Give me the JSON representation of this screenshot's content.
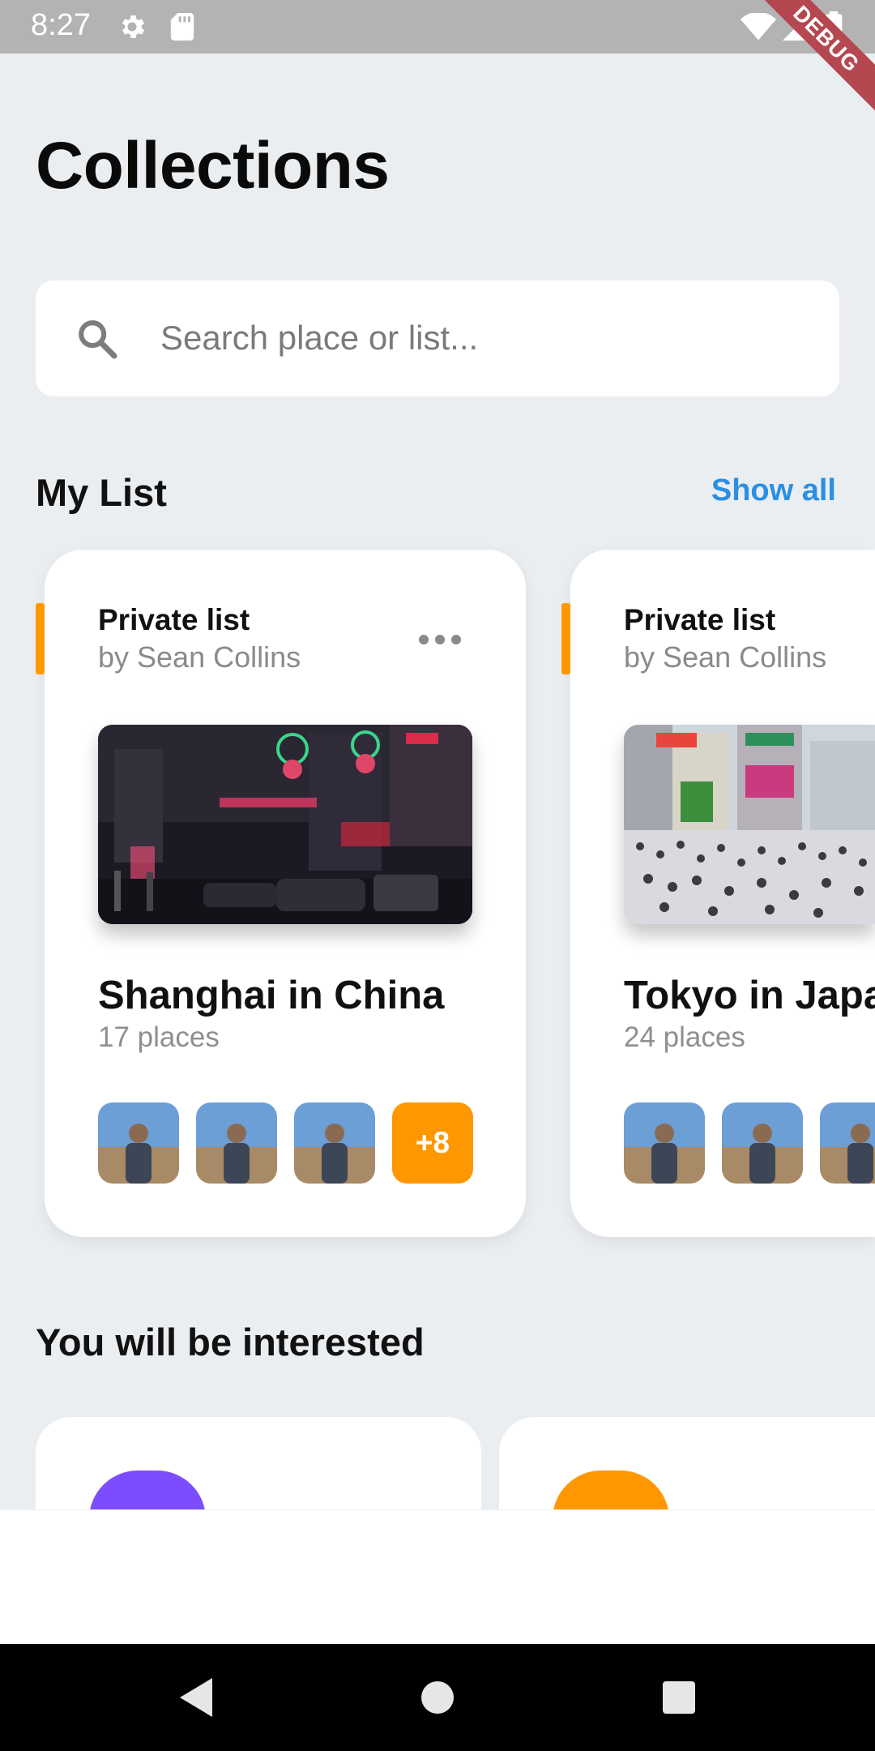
{
  "status_bar": {
    "time": "8:27",
    "icons": [
      "gear-icon",
      "sd-card-icon",
      "wifi-icon",
      "cell-signal-icon",
      "battery-icon"
    ],
    "debug_label": "DEBUG"
  },
  "header": {
    "title": "Collections"
  },
  "search": {
    "placeholder": "Search place or list...",
    "value": ""
  },
  "my_list": {
    "title": "My List",
    "show_all_label": "Show all",
    "cards": [
      {
        "type": "Private list",
        "author": "by Sean Collins",
        "title": "Shanghai in China",
        "count": "17 places",
        "more_badge": "+8"
      },
      {
        "type": "Private list",
        "author": "by Sean Collins",
        "title": "Tokyo in Japan",
        "count": "24 places"
      }
    ]
  },
  "interested": {
    "title": "You will be interested"
  },
  "colors": {
    "accent_orange": "#ff9800",
    "link_blue": "#2b8fe2",
    "purple": "#7c4dff",
    "background": "#ebeef1"
  }
}
